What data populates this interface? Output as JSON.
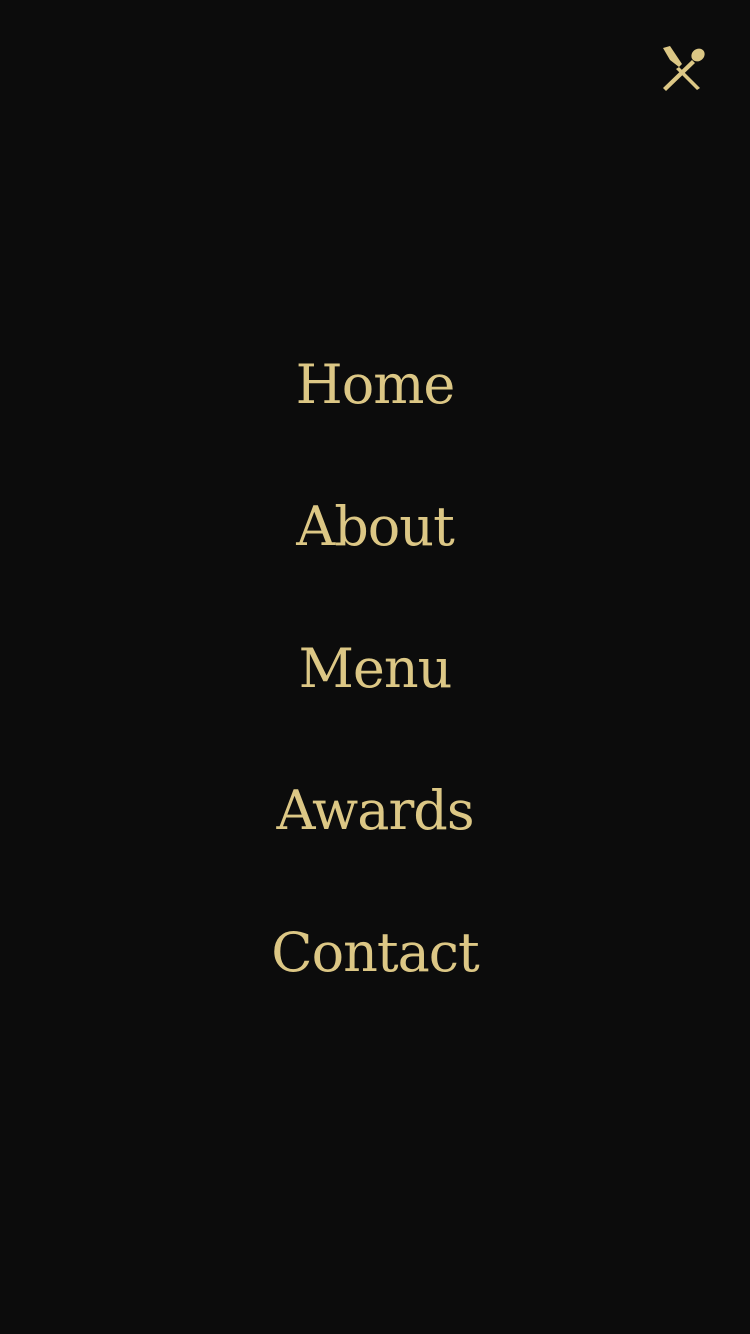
{
  "colors": {
    "background": "#0c0c0c",
    "accent": "#dcc785"
  },
  "header": {
    "close_icon": "fork-knife-cross-icon"
  },
  "nav": {
    "items": [
      {
        "label": "Home"
      },
      {
        "label": "About"
      },
      {
        "label": "Menu"
      },
      {
        "label": "Awards"
      },
      {
        "label": "Contact"
      }
    ]
  }
}
